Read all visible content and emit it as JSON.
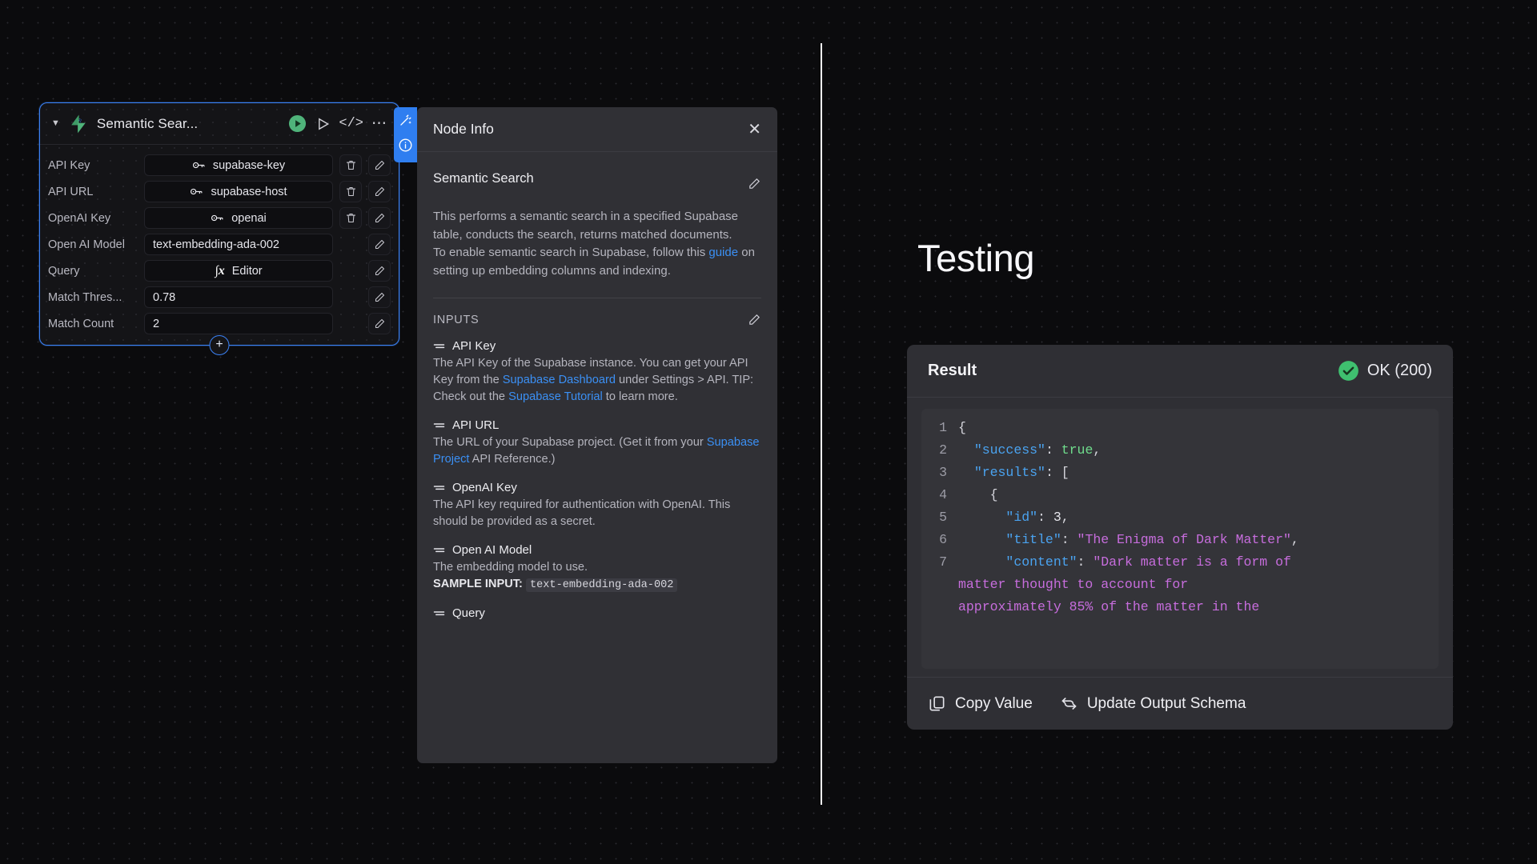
{
  "node": {
    "title": "Semantic Sear...",
    "icons": {
      "collapse": "caret-down-icon",
      "logo": "supabase-logo-icon",
      "run": "run-green-icon",
      "play": "play-outline-icon",
      "code": "code-icon",
      "more": "more-options-icon",
      "add": "add-node-icon"
    },
    "params": [
      {
        "label": "API Key",
        "value": "supabase-key",
        "kind": "secret",
        "align": "center",
        "has_delete": true,
        "has_edit": true
      },
      {
        "label": "API URL",
        "value": "supabase-host",
        "kind": "secret",
        "align": "center",
        "has_delete": true,
        "has_edit": true
      },
      {
        "label": "OpenAI Key",
        "value": "openai",
        "kind": "secret",
        "align": "center",
        "has_delete": true,
        "has_edit": true
      },
      {
        "label": "Open AI Model",
        "value": "text-embedding-ada-002",
        "kind": "text",
        "align": "left",
        "has_delete": false,
        "has_edit": true
      },
      {
        "label": "Query",
        "value": "Editor",
        "kind": "function",
        "align": "center",
        "has_delete": false,
        "has_edit": true
      },
      {
        "label": "Match Thres...",
        "value": "0.78",
        "kind": "text",
        "align": "left",
        "has_delete": false,
        "has_edit": true
      },
      {
        "label": "Match Count",
        "value": "2",
        "kind": "text",
        "align": "left",
        "has_delete": false,
        "has_edit": true
      }
    ]
  },
  "tabs": [
    {
      "icon": "magic-wand-icon",
      "name": "tab-magic"
    },
    {
      "icon": "info-circle-icon",
      "name": "tab-info"
    }
  ],
  "info": {
    "panel_title": "Node Info",
    "close_label": "✕",
    "section_title": "Semantic Search",
    "desc_1": "This performs a semantic search in a specified Supabase table, conducts the search, returns matched documents.",
    "desc_2_before": "To enable semantic search in Supabase, follow this ",
    "desc_2_link": "guide",
    "desc_2_after": " on setting up embedding columns and indexing.",
    "inputs_label": "INPUTS",
    "inputs": [
      {
        "name": "API Key",
        "parts": [
          {
            "t": "The API Key of the Supabase instance. You can get your API Key from the "
          },
          {
            "t": "Supabase Dashboard",
            "link": true
          },
          {
            "t": " under Settings > API."
          },
          {
            "t": "\nTIP: Check out the "
          },
          {
            "t": "Supabase Tutorial",
            "link": true
          },
          {
            "t": " to learn more."
          }
        ]
      },
      {
        "name": "API URL",
        "parts": [
          {
            "t": "The URL of your Supabase project. (Get it from your "
          },
          {
            "t": "Supabase Project",
            "link": true
          },
          {
            "t": " API Reference.)"
          }
        ]
      },
      {
        "name": "OpenAI Key",
        "parts": [
          {
            "t": "The API key required for authentication with OpenAI. This should be provided as a secret."
          }
        ]
      },
      {
        "name": "Open AI Model",
        "parts": [
          {
            "t": "The embedding model to use."
          }
        ],
        "sample_label": "SAMPLE INPUT:",
        "sample_value": "text-embedding-ada-002"
      },
      {
        "name": "Query",
        "parts": []
      }
    ]
  },
  "testing": {
    "title": "Testing",
    "result": {
      "header": "Result",
      "status": "OK (200)",
      "status_icon": "check-circle-icon",
      "status_color": "#3fbf6f",
      "code_lines": [
        {
          "num": "1",
          "tokens": [
            {
              "t": "{",
              "c": "p"
            }
          ]
        },
        {
          "num": "2",
          "tokens": [
            {
              "t": "  ",
              "c": "p"
            },
            {
              "t": "\"success\"",
              "c": "k"
            },
            {
              "t": ": ",
              "c": "p"
            },
            {
              "t": "true",
              "c": "b"
            },
            {
              "t": ",",
              "c": "p"
            }
          ]
        },
        {
          "num": "3",
          "tokens": [
            {
              "t": "  ",
              "c": "p"
            },
            {
              "t": "\"results\"",
              "c": "k"
            },
            {
              "t": ": ",
              "c": "p"
            },
            {
              "t": "[",
              "c": "p"
            }
          ]
        },
        {
          "num": "4",
          "tokens": [
            {
              "t": "    {",
              "c": "p"
            }
          ]
        },
        {
          "num": "5",
          "tokens": [
            {
              "t": "      ",
              "c": "p"
            },
            {
              "t": "\"id\"",
              "c": "k"
            },
            {
              "t": ": ",
              "c": "p"
            },
            {
              "t": "3",
              "c": "n"
            },
            {
              "t": ",",
              "c": "p"
            }
          ]
        },
        {
          "num": "6",
          "tokens": [
            {
              "t": "      ",
              "c": "p"
            },
            {
              "t": "\"title\"",
              "c": "k"
            },
            {
              "t": ": ",
              "c": "p"
            },
            {
              "t": "\"The Enigma of Dark Matter\"",
              "c": "s"
            },
            {
              "t": ",",
              "c": "p"
            }
          ]
        },
        {
          "num": "7",
          "tokens": [
            {
              "t": "      ",
              "c": "p"
            },
            {
              "t": "\"content\"",
              "c": "k"
            },
            {
              "t": ": ",
              "c": "p"
            },
            {
              "t": "\"Dark matter is a form of",
              "c": "s"
            }
          ]
        }
      ],
      "code_wrap_lines": [
        {
          "t": "matter thought to account for",
          "c": "s"
        },
        {
          "t": "approximately 85% of the matter in the",
          "c": "s"
        }
      ],
      "footer": [
        {
          "label": "Copy Value",
          "icon": "copy-icon",
          "name": "copy-value-button"
        },
        {
          "label": "Update Output Schema",
          "icon": "refresh-icon",
          "name": "update-output-schema-button"
        }
      ]
    }
  }
}
